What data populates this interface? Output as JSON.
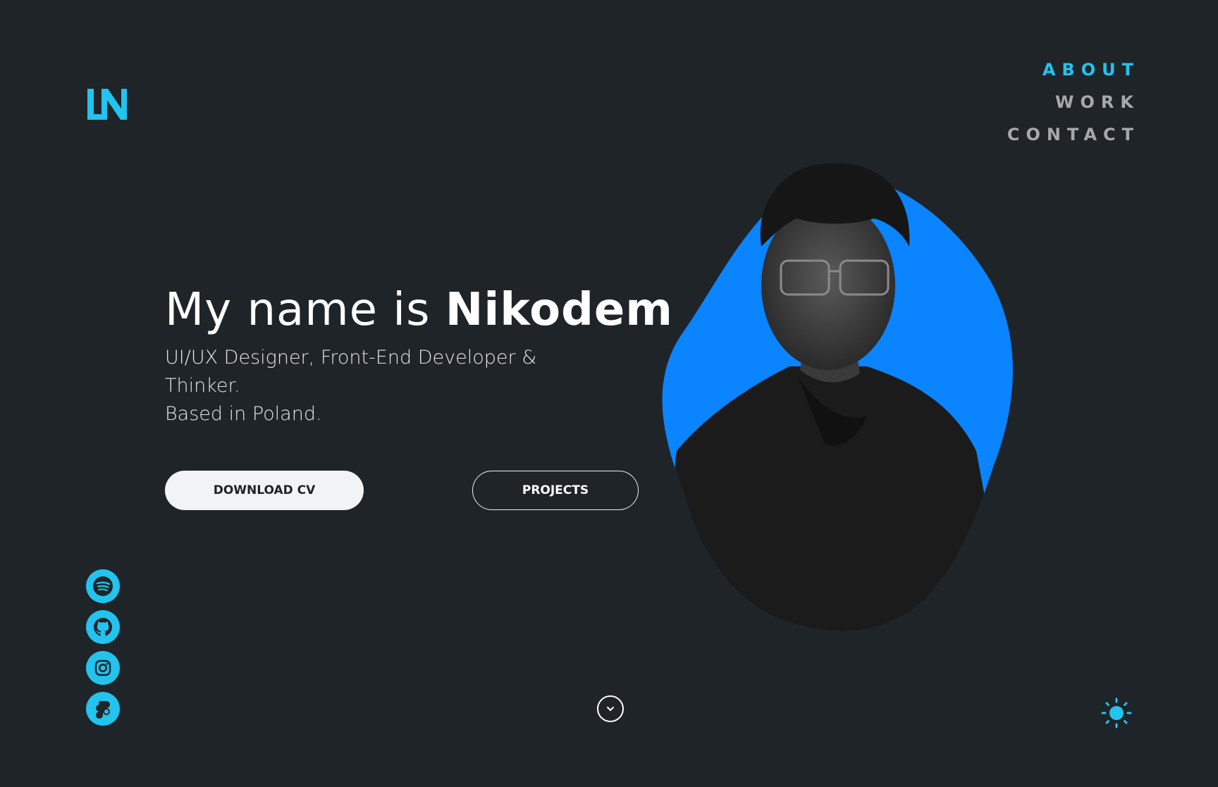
{
  "brand": {
    "logo_text": "LN",
    "accent": "#22c3ee"
  },
  "nav": {
    "items": [
      {
        "label": "ABOUT",
        "active": true
      },
      {
        "label": "WORK",
        "active": false
      },
      {
        "label": "CONTACT",
        "active": false
      }
    ]
  },
  "hero": {
    "headline_prefix": "My name is ",
    "headline_name": "Nikodem",
    "subtitle_line1": "UI/UX Designer, Front-End Developer & Thinker.",
    "subtitle_line2": "Based in Poland."
  },
  "buttons": {
    "download_cv": "DOWNLOAD CV",
    "projects": "PROJECTS"
  },
  "socials": [
    "spotify-icon",
    "github-icon",
    "instagram-icon",
    "figma-icon"
  ],
  "colors": {
    "background": "#1f2428",
    "blob": "#0a84ff",
    "accent": "#22c3ee"
  }
}
